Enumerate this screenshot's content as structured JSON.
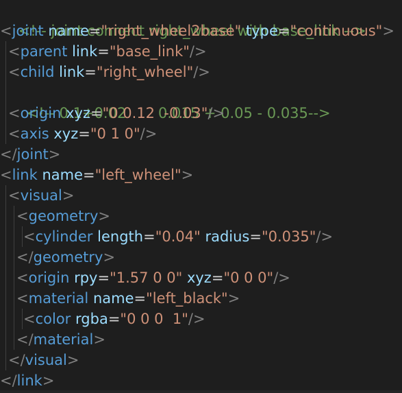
{
  "colors": {
    "background": "#1e1e1e",
    "comment": "#6a9955",
    "bracket": "#808080",
    "tag_name": "#569cd6",
    "attribute": "#9cdcfe",
    "string": "#ce9178"
  },
  "code": {
    "l1": {
      "comment": "<!-- joint connect right_wheel with base_link -->"
    },
    "l2": {
      "open": "<",
      "tag": "joint",
      "a1": "name",
      "eq1": "=",
      "v1": "\"right_wheel2base\"",
      "a2": "type",
      "eq2": "=",
      "v2": "\"continuous\"",
      "close": ">"
    },
    "l3": {
      "open": "<",
      "tag": "parent",
      "a1": "link",
      "eq1": "=",
      "v1": "\"base_link\"",
      "close": "/>"
    },
    "l4": {
      "open": "<",
      "tag": "child",
      "a1": "link",
      "eq1": "=",
      "v1": "\"right_wheel\"",
      "close": "/>"
    },
    "l5": {
      "comment": "<!-- 0.1+0.02       0.015 + 0.05 - 0.035-->"
    },
    "l6": {
      "open": "<",
      "tag": "origin",
      "a1": "xyz",
      "eq1": "=",
      "v1": "\"0 0.12  -0.03\"",
      "close": "/>"
    },
    "l7": {
      "open": "<",
      "tag": "axis",
      "a1": "xyz",
      "eq1": "=",
      "v1": "\"0 1 0\"",
      "close": "/>"
    },
    "l8": {
      "open": "</",
      "tag": "joint",
      "close": ">"
    },
    "l9": {
      "open": "<",
      "tag": "link",
      "a1": "name",
      "eq1": "=",
      "v1": "\"left_wheel\"",
      "close": ">"
    },
    "l10": {
      "open": "<",
      "tag": "visual",
      "close": ">"
    },
    "l11": {
      "open": "<",
      "tag": "geometry",
      "close": ">"
    },
    "l12": {
      "open": "<",
      "tag": "cylinder",
      "a1": "length",
      "eq1": "=",
      "v1": "\"0.04\"",
      "a2": "radius",
      "eq2": "=",
      "v2": "\"0.035\"",
      "close": "/>"
    },
    "l13": {
      "open": "</",
      "tag": "geometry",
      "close": ">"
    },
    "l14": {
      "open": "<",
      "tag": "origin",
      "a1": "rpy",
      "eq1": "=",
      "v1": "\"1.57 0 0\"",
      "a2": "xyz",
      "eq2": "=",
      "v2": "\"0 0 0\"",
      "close": "/>"
    },
    "l15": {
      "open": "<",
      "tag": "material",
      "a1": "name",
      "eq1": "=",
      "v1": "\"left_black\"",
      "close": ">"
    },
    "l16": {
      "open": "<",
      "tag": "color",
      "a1": "rgba",
      "eq1": "=",
      "v1": "\"0 0 0  1\"",
      "close": "/>"
    },
    "l17": {
      "open": "</",
      "tag": "material",
      "close": ">"
    },
    "l18": {
      "open": "</",
      "tag": "visual",
      "close": ">"
    },
    "l19": {
      "open": "</",
      "tag": "link",
      "close": ">"
    }
  }
}
